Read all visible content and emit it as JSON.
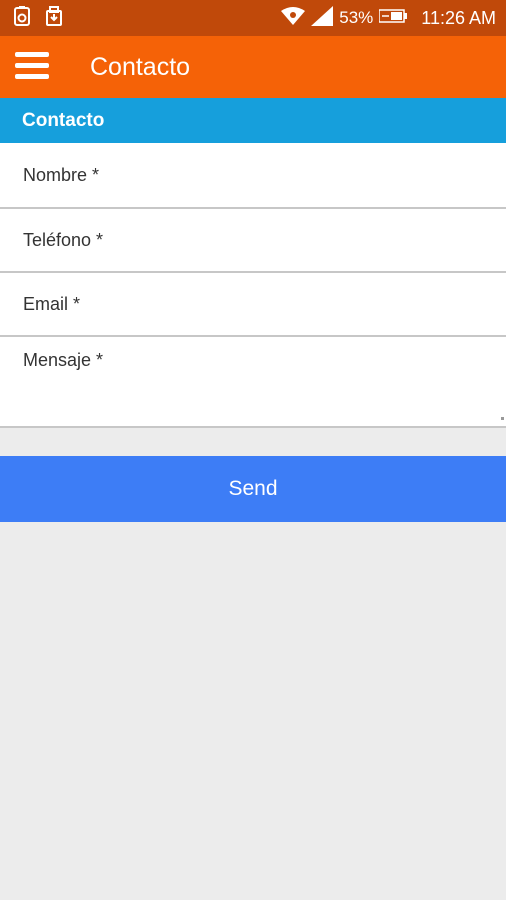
{
  "status_bar": {
    "battery_percent": "53%",
    "time": "11:26 AM",
    "icons": [
      "camera-notification-icon",
      "download-notification-icon",
      "wifi-icon",
      "signal-icon",
      "battery-icon"
    ]
  },
  "app_bar": {
    "title": "Contacto",
    "menu_icon": "hamburger-menu-icon"
  },
  "section": {
    "title": "Contacto"
  },
  "form": {
    "nombre_placeholder": "Nombre *",
    "telefono_placeholder": "Teléfono *",
    "email_placeholder": "Email *",
    "mensaje_placeholder": "Mensaje *",
    "send_label": "Send"
  },
  "colors": {
    "status_bar": "#c0490a",
    "app_bar": "#f56207",
    "section_header": "#169fdc",
    "send_button": "#3d7df6",
    "background": "#ececec"
  }
}
